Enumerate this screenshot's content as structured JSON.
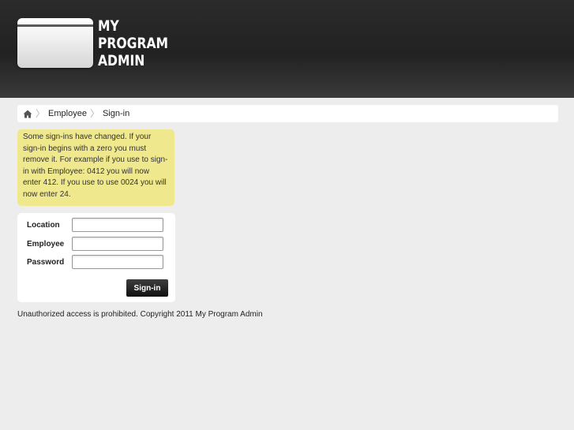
{
  "header": {
    "logo_line1": "MY",
    "logo_line2": "PROGRAM",
    "logo_line3": "ADMIN"
  },
  "breadcrumb": {
    "home_icon": "home-icon",
    "items": [
      "Employee",
      "Sign-in"
    ],
    "separator": "〉"
  },
  "notice": {
    "text": "Some sign-ins have changed. If your sign-in begins with a zero you must remove it. For example if you use to sign-in with Employee: 0412 you will now enter 412. If you use to use 0024 you will now enter 24."
  },
  "form": {
    "location_label": "Location",
    "location_value": "",
    "employee_label": "Employee",
    "employee_value": "",
    "password_label": "Password",
    "password_value": "",
    "submit_label": "Sign-in"
  },
  "footer": {
    "text": "Unauthorized access is prohibited. Copyright 2011 My Program Admin"
  },
  "colors": {
    "notice_bg": "#efe88c",
    "page_bg": "#ededed",
    "header_bg": "#262626"
  }
}
